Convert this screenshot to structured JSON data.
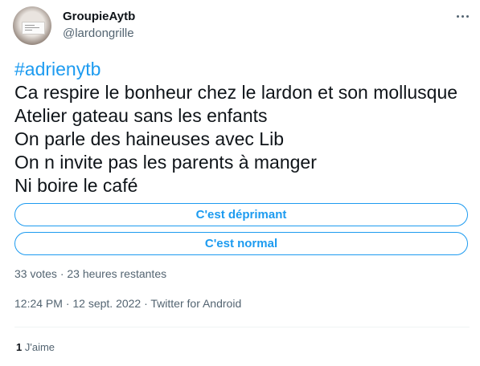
{
  "author": {
    "display_name": "GroupieAytb",
    "handle": "@lardongrille",
    "avatar_icon": "avatar-image"
  },
  "tweet": {
    "hashtag": "#adrienytb",
    "lines": [
      "Ca respire le bonheur chez le lardon et son mollusque",
      "Atelier gateau sans les enfants",
      "On parle des haineuses avec Lib",
      "On n invite pas les parents à manger",
      "Ni boire le café"
    ]
  },
  "poll": {
    "options": [
      "C'est déprimant",
      "C'est normal"
    ],
    "meta": "33 votes · 23 heures restantes"
  },
  "timestamp": "12:24 PM · 12 sept. 2022 · Twitter for Android",
  "likes": {
    "count": "1",
    "label": "J'aime"
  },
  "colors": {
    "accent": "#1d9bf0",
    "text": "#0f1419",
    "secondary": "#536471"
  },
  "icons": {
    "more": "more-options-icon"
  }
}
